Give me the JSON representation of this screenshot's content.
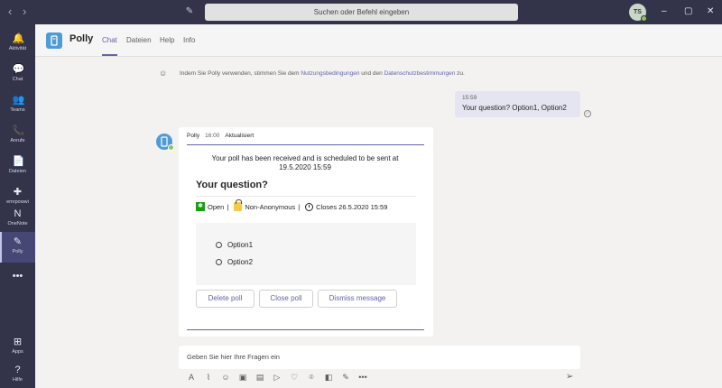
{
  "titlebar": {
    "search_placeholder": "Suchen oder Befehl eingeben",
    "avatar_initials": "TS",
    "back": "‹",
    "forward": "›",
    "compose": "✎",
    "minimize": "–",
    "maximize": "▢",
    "close": "✕"
  },
  "rail": [
    {
      "label": "Aktivität",
      "icon": "bell-icon",
      "glyph": "🔔"
    },
    {
      "label": "Chat",
      "icon": "chat-icon",
      "glyph": "💬"
    },
    {
      "label": "Teams",
      "icon": "teams-icon",
      "glyph": "👥"
    },
    {
      "label": "Anrufe",
      "icon": "phone-icon",
      "glyph": "📞"
    },
    {
      "label": "Dateien",
      "icon": "file-icon",
      "glyph": "📄"
    },
    {
      "label": "emrpowwi",
      "icon": "app-icon",
      "glyph": "✚"
    },
    {
      "label": "OneNote",
      "icon": "onenote-icon",
      "glyph": "N"
    },
    {
      "label": "Polly",
      "icon": "polly-icon",
      "glyph": "✎"
    },
    {
      "label": "",
      "icon": "more-icon",
      "glyph": "•••"
    },
    {
      "label": "Apps",
      "icon": "apps-icon",
      "glyph": "⊞"
    },
    {
      "label": "Hilfe",
      "icon": "help-icon",
      "glyph": "?"
    }
  ],
  "header": {
    "app_name": "Polly",
    "tabs": [
      "Chat",
      "Dateien",
      "Help",
      "Info"
    ]
  },
  "notice": {
    "prefix": "Indem Sie Polly verwenden, stimmen Sie dem ",
    "terms": "Nutzungsbedingungen",
    "middle": " und den ",
    "privacy": "Datenschutzbestimmungen",
    "suffix": " zu."
  },
  "my_message": {
    "time": "15:59",
    "text": "Your question? Option1, Option2"
  },
  "bot_message": {
    "sender": "Polly",
    "time": "16:00",
    "status": "Aktualisiert",
    "received_text": "Your poll has been received and is scheduled to be sent at 19.5.2020 15:59",
    "question": "Your question?",
    "open_label": "Open",
    "anon_label": "Non-Anonymous",
    "closes_label": "Closes 26.5.2020 15:59",
    "options": [
      "Option1",
      "Option2"
    ],
    "buttons": [
      "Delete poll",
      "Close poll",
      "Dismiss message"
    ]
  },
  "compose": {
    "placeholder": "Geben Sie hier Ihre Fragen ein"
  },
  "colors": {
    "accent": "#6264a7",
    "rail_bg": "#33344a",
    "status_green": "#13a10e"
  }
}
